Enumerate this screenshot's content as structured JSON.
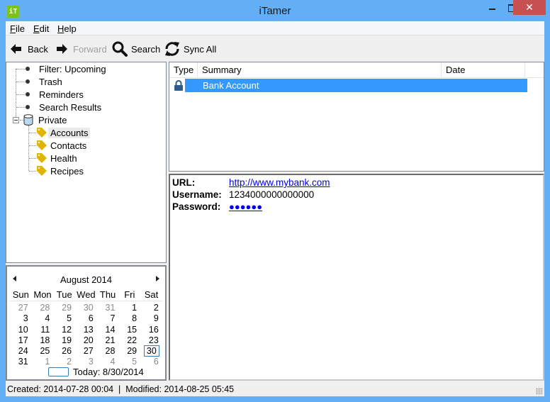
{
  "window": {
    "title": "iTamer",
    "app_icon_text": "iT",
    "close_glyph": "✕"
  },
  "menu": [
    {
      "label": "File",
      "mnemonic": "F",
      "rest": "ile"
    },
    {
      "label": "Edit",
      "mnemonic": "E",
      "rest": "dit"
    },
    {
      "label": "Help",
      "mnemonic": "H",
      "rest": "elp"
    }
  ],
  "toolbar": {
    "back": "Back",
    "forward": "Forward",
    "search": "Search",
    "sync": "Sync All"
  },
  "tree": {
    "items": [
      {
        "label": "Filter: Upcoming",
        "icon": "bullet"
      },
      {
        "label": "Trash",
        "icon": "bullet"
      },
      {
        "label": "Reminders",
        "icon": "bullet"
      },
      {
        "label": "Search Results",
        "icon": "bullet"
      },
      {
        "label": "Private",
        "icon": "database",
        "expanded": true
      },
      {
        "label": "Accounts",
        "icon": "tag",
        "selected": true
      },
      {
        "label": "Contacts",
        "icon": "tag"
      },
      {
        "label": "Health",
        "icon": "tag"
      },
      {
        "label": "Recipes",
        "icon": "tag"
      }
    ]
  },
  "calendar": {
    "month_title": "August 2014",
    "days_of_week": [
      "Sun",
      "Mon",
      "Tue",
      "Wed",
      "Thu",
      "Fri",
      "Sat"
    ],
    "weeks": [
      [
        "27",
        "28",
        "29",
        "30",
        "31",
        "1",
        "2"
      ],
      [
        "3",
        "4",
        "5",
        "6",
        "7",
        "8",
        "9"
      ],
      [
        "10",
        "11",
        "12",
        "13",
        "14",
        "15",
        "16"
      ],
      [
        "17",
        "18",
        "19",
        "20",
        "21",
        "22",
        "23"
      ],
      [
        "24",
        "25",
        "26",
        "27",
        "28",
        "29",
        "30"
      ],
      [
        "31",
        "1",
        "2",
        "3",
        "4",
        "5",
        "6"
      ]
    ],
    "selected_day": "30",
    "today_label": "Today: 8/30/2014"
  },
  "list": {
    "columns": [
      "Type",
      "Summary",
      "Date"
    ],
    "rows": [
      {
        "type_icon": "lock",
        "summary": "Bank Account",
        "date": "",
        "selected": true
      }
    ]
  },
  "detail": {
    "fields": [
      {
        "key": "URL:",
        "value": "http://www.mybank.com",
        "link": true
      },
      {
        "key": "Username:",
        "value": "1234000000000000",
        "link": false
      },
      {
        "key": "Password:",
        "value": "●●●●●●",
        "link": true
      }
    ]
  },
  "status": {
    "text": "Created: 2014-07-28 00:04  |  Modified: 2014-08-25 05:45"
  },
  "colors": {
    "titlebar": "#63aff5",
    "close_button": "#c75050",
    "selection": "#3399ff",
    "link": "#0000ee",
    "tag": "#e0b400",
    "app_icon": "#7cc21c"
  }
}
